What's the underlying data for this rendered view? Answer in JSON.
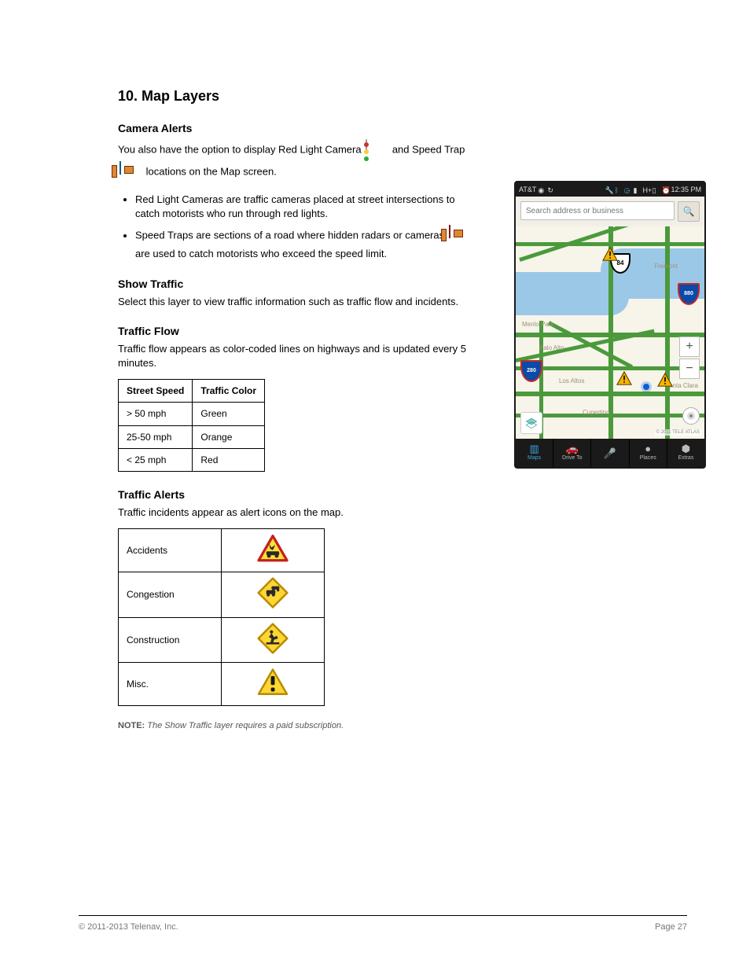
{
  "page": {
    "footer_left": "© 2011-2013 Telenav, Inc.",
    "footer_right": "Page 27",
    "chapter": "10. Map Layers"
  },
  "section": {
    "camera_alerts": {
      "title": "Camera Alerts",
      "p1_a": "You also have the option to display Red Light Camera",
      "p1_b": "and Speed Trap",
      "p1_c": "locations on the Map screen.",
      "bullets": [
        "Red Light Cameras are traffic cameras placed at street intersections to catch motorists who run through red lights.",
        "Speed Traps are sections of a road where hidden radars or cameras"
      ],
      "bullet2_suffix": "are used to catch motorists who exceed the speed limit."
    },
    "show_traffic": {
      "title": "Show Traffic",
      "intro": "Select this layer to view traffic information such as traffic flow and incidents."
    },
    "traffic_flow": {
      "title": "Traffic Flow",
      "intro": "Traffic flow appears as color-coded lines on highways and is updated every 5 minutes."
    },
    "traffic_alerts": {
      "title": "Traffic Alerts",
      "intro": "Traffic incidents appear as alert icons on the map."
    },
    "note_label": "NOTE:",
    "note_text": "The Show Traffic layer requires a paid subscription."
  },
  "traffic_flow_table": {
    "headers": [
      "Street Speed",
      "Traffic Color"
    ],
    "rows": [
      [
        "> 50 mph",
        "Green"
      ],
      [
        "25-50 mph",
        "Orange"
      ],
      [
        "< 25 mph",
        "Red"
      ]
    ]
  },
  "alerts_table": [
    {
      "label": "Accidents",
      "kind": "accident"
    },
    {
      "label": "Congestion",
      "kind": "congestion"
    },
    {
      "label": "Construction",
      "kind": "construction"
    },
    {
      "label": "Misc.",
      "kind": "misc"
    }
  ],
  "phone": {
    "carrier": "AT&T",
    "time": "12:35 PM",
    "search_placeholder": "Search address or business",
    "cities": {
      "fremont": "Fremont",
      "menlo": "Menlo Park",
      "paloalto": "Palo Alto",
      "losaltos": "Los Altos",
      "santaclara": "Santa Clara",
      "cupertino": "Cupertino"
    },
    "shields": {
      "s84": "84",
      "s880": "880",
      "s280": "280"
    },
    "map_credit": "© 2011 TELE ATLAS",
    "tabs": [
      {
        "key": "maps",
        "label": "Maps",
        "glyph": "▥",
        "active": true
      },
      {
        "key": "driveto",
        "label": "Drive To",
        "glyph": "🚗",
        "active": false
      },
      {
        "key": "voice",
        "label": "",
        "glyph": "🎤",
        "active": false
      },
      {
        "key": "places",
        "label": "Places",
        "glyph": "●",
        "active": false
      },
      {
        "key": "extras",
        "label": "Extras",
        "glyph": "⬢",
        "active": false
      }
    ]
  }
}
